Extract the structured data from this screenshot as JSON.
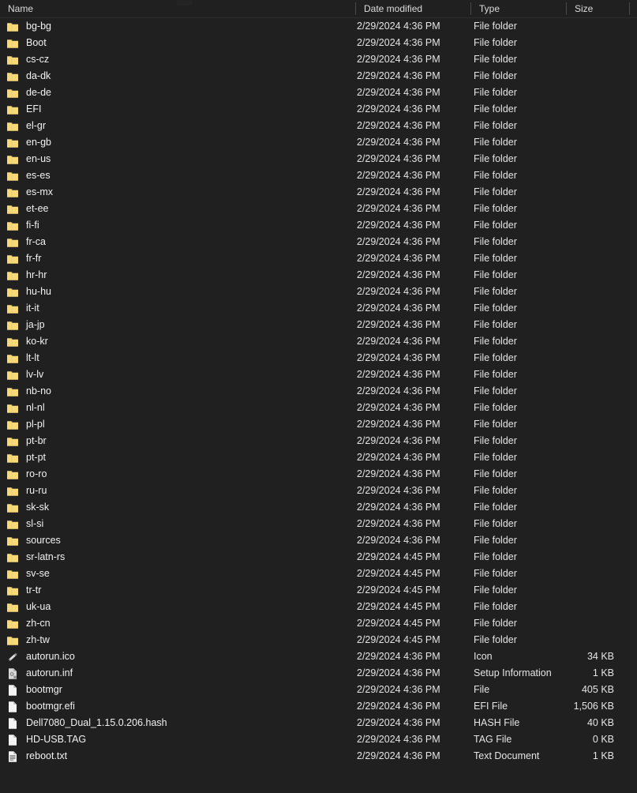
{
  "window": {
    "view_mode": "details-list"
  },
  "colors": {
    "background": "#202020",
    "text": "#f2f2f2",
    "secondary_text": "#e4e4e4",
    "header_text": "#dcdcdc",
    "separator": "#4a4a4a",
    "folder_icon": "#f7d97a",
    "file_icon": "#f3f3f3"
  },
  "columns": [
    {
      "key": "name",
      "label": "Name"
    },
    {
      "key": "date",
      "label": "Date modified"
    },
    {
      "key": "type",
      "label": "Type"
    },
    {
      "key": "size",
      "label": "Size"
    }
  ],
  "items": [
    {
      "name": "bg-bg",
      "date": "2/29/2024 4:36 PM",
      "type": "File folder",
      "size": "",
      "icon": "folder-icon"
    },
    {
      "name": "Boot",
      "date": "2/29/2024 4:36 PM",
      "type": "File folder",
      "size": "",
      "icon": "folder-icon"
    },
    {
      "name": "cs-cz",
      "date": "2/29/2024 4:36 PM",
      "type": "File folder",
      "size": "",
      "icon": "folder-icon"
    },
    {
      "name": "da-dk",
      "date": "2/29/2024 4:36 PM",
      "type": "File folder",
      "size": "",
      "icon": "folder-icon"
    },
    {
      "name": "de-de",
      "date": "2/29/2024 4:36 PM",
      "type": "File folder",
      "size": "",
      "icon": "folder-icon"
    },
    {
      "name": "EFI",
      "date": "2/29/2024 4:36 PM",
      "type": "File folder",
      "size": "",
      "icon": "folder-icon"
    },
    {
      "name": "el-gr",
      "date": "2/29/2024 4:36 PM",
      "type": "File folder",
      "size": "",
      "icon": "folder-icon"
    },
    {
      "name": "en-gb",
      "date": "2/29/2024 4:36 PM",
      "type": "File folder",
      "size": "",
      "icon": "folder-icon"
    },
    {
      "name": "en-us",
      "date": "2/29/2024 4:36 PM",
      "type": "File folder",
      "size": "",
      "icon": "folder-icon"
    },
    {
      "name": "es-es",
      "date": "2/29/2024 4:36 PM",
      "type": "File folder",
      "size": "",
      "icon": "folder-icon"
    },
    {
      "name": "es-mx",
      "date": "2/29/2024 4:36 PM",
      "type": "File folder",
      "size": "",
      "icon": "folder-icon"
    },
    {
      "name": "et-ee",
      "date": "2/29/2024 4:36 PM",
      "type": "File folder",
      "size": "",
      "icon": "folder-icon"
    },
    {
      "name": "fi-fi",
      "date": "2/29/2024 4:36 PM",
      "type": "File folder",
      "size": "",
      "icon": "folder-icon"
    },
    {
      "name": "fr-ca",
      "date": "2/29/2024 4:36 PM",
      "type": "File folder",
      "size": "",
      "icon": "folder-icon"
    },
    {
      "name": "fr-fr",
      "date": "2/29/2024 4:36 PM",
      "type": "File folder",
      "size": "",
      "icon": "folder-icon"
    },
    {
      "name": "hr-hr",
      "date": "2/29/2024 4:36 PM",
      "type": "File folder",
      "size": "",
      "icon": "folder-icon"
    },
    {
      "name": "hu-hu",
      "date": "2/29/2024 4:36 PM",
      "type": "File folder",
      "size": "",
      "icon": "folder-icon"
    },
    {
      "name": "it-it",
      "date": "2/29/2024 4:36 PM",
      "type": "File folder",
      "size": "",
      "icon": "folder-icon"
    },
    {
      "name": "ja-jp",
      "date": "2/29/2024 4:36 PM",
      "type": "File folder",
      "size": "",
      "icon": "folder-icon"
    },
    {
      "name": "ko-kr",
      "date": "2/29/2024 4:36 PM",
      "type": "File folder",
      "size": "",
      "icon": "folder-icon"
    },
    {
      "name": "lt-lt",
      "date": "2/29/2024 4:36 PM",
      "type": "File folder",
      "size": "",
      "icon": "folder-icon"
    },
    {
      "name": "lv-lv",
      "date": "2/29/2024 4:36 PM",
      "type": "File folder",
      "size": "",
      "icon": "folder-icon"
    },
    {
      "name": "nb-no",
      "date": "2/29/2024 4:36 PM",
      "type": "File folder",
      "size": "",
      "icon": "folder-icon"
    },
    {
      "name": "nl-nl",
      "date": "2/29/2024 4:36 PM",
      "type": "File folder",
      "size": "",
      "icon": "folder-icon"
    },
    {
      "name": "pl-pl",
      "date": "2/29/2024 4:36 PM",
      "type": "File folder",
      "size": "",
      "icon": "folder-icon"
    },
    {
      "name": "pt-br",
      "date": "2/29/2024 4:36 PM",
      "type": "File folder",
      "size": "",
      "icon": "folder-icon"
    },
    {
      "name": "pt-pt",
      "date": "2/29/2024 4:36 PM",
      "type": "File folder",
      "size": "",
      "icon": "folder-icon"
    },
    {
      "name": "ro-ro",
      "date": "2/29/2024 4:36 PM",
      "type": "File folder",
      "size": "",
      "icon": "folder-icon"
    },
    {
      "name": "ru-ru",
      "date": "2/29/2024 4:36 PM",
      "type": "File folder",
      "size": "",
      "icon": "folder-icon"
    },
    {
      "name": "sk-sk",
      "date": "2/29/2024 4:36 PM",
      "type": "File folder",
      "size": "",
      "icon": "folder-icon"
    },
    {
      "name": "sl-si",
      "date": "2/29/2024 4:36 PM",
      "type": "File folder",
      "size": "",
      "icon": "folder-icon"
    },
    {
      "name": "sources",
      "date": "2/29/2024 4:36 PM",
      "type": "File folder",
      "size": "",
      "icon": "folder-icon"
    },
    {
      "name": "sr-latn-rs",
      "date": "2/29/2024 4:45 PM",
      "type": "File folder",
      "size": "",
      "icon": "folder-icon"
    },
    {
      "name": "sv-se",
      "date": "2/29/2024 4:45 PM",
      "type": "File folder",
      "size": "",
      "icon": "folder-icon"
    },
    {
      "name": "tr-tr",
      "date": "2/29/2024 4:45 PM",
      "type": "File folder",
      "size": "",
      "icon": "folder-icon"
    },
    {
      "name": "uk-ua",
      "date": "2/29/2024 4:45 PM",
      "type": "File folder",
      "size": "",
      "icon": "folder-icon"
    },
    {
      "name": "zh-cn",
      "date": "2/29/2024 4:45 PM",
      "type": "File folder",
      "size": "",
      "icon": "folder-icon"
    },
    {
      "name": "zh-tw",
      "date": "2/29/2024 4:45 PM",
      "type": "File folder",
      "size": "",
      "icon": "folder-icon"
    },
    {
      "name": "autorun.ico",
      "date": "2/29/2024 4:36 PM",
      "type": "Icon",
      "size": "34 KB",
      "icon": "icon-file-icon"
    },
    {
      "name": "autorun.inf",
      "date": "2/29/2024 4:36 PM",
      "type": "Setup Information",
      "size": "1 KB",
      "icon": "setup-information-icon"
    },
    {
      "name": "bootmgr",
      "date": "2/29/2024 4:36 PM",
      "type": "File",
      "size": "405 KB",
      "icon": "generic-file-icon"
    },
    {
      "name": "bootmgr.efi",
      "date": "2/29/2024 4:36 PM",
      "type": "EFI File",
      "size": "1,506 KB",
      "icon": "generic-file-icon"
    },
    {
      "name": "Dell7080_Dual_1.15.0.206.hash",
      "date": "2/29/2024 4:36 PM",
      "type": "HASH File",
      "size": "40 KB",
      "icon": "generic-file-icon"
    },
    {
      "name": "HD-USB.TAG",
      "date": "2/29/2024 4:36 PM",
      "type": "TAG File",
      "size": "0 KB",
      "icon": "generic-file-icon"
    },
    {
      "name": "reboot.txt",
      "date": "2/29/2024 4:36 PM",
      "type": "Text Document",
      "size": "1 KB",
      "icon": "text-document-icon"
    }
  ]
}
